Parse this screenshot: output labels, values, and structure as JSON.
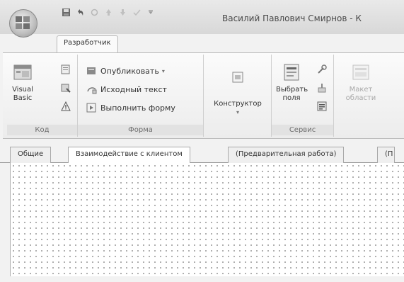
{
  "window": {
    "title": "Василий Павлович Смирнов - К"
  },
  "ribbon": {
    "active_tab": "Разработчик",
    "groups": {
      "code": {
        "label": "Код",
        "visual_basic": "Visual Basic"
      },
      "form": {
        "label": "Форма",
        "publish": "Опубликовать",
        "source_text": "Исходный текст",
        "run_form": "Выполнить форму"
      },
      "designer": {
        "label": "Конструктор"
      },
      "service": {
        "label": "Сервис",
        "choose_fields": "Выбрать поля"
      },
      "layout": {
        "area_layout": "Макет области"
      }
    }
  },
  "form_tabs": [
    "Общие",
    "Взаимодействие с клиентом",
    "(Предварительная работа)",
    "(П"
  ],
  "form_tabs_active": 1
}
